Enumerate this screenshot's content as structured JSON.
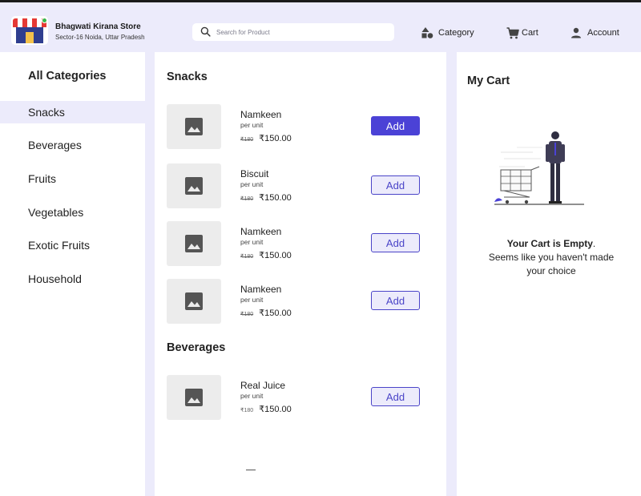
{
  "store": {
    "name": "Bhagwati Kirana Store",
    "address": "Sector-16 Noida, Uttar Pradesh"
  },
  "search": {
    "placeholder": "Search for Product"
  },
  "nav": {
    "category": "Category",
    "cart": "Cart",
    "account": "Account"
  },
  "sidebar": {
    "title": "All Categories",
    "items": [
      {
        "label": "Snacks",
        "active": true
      },
      {
        "label": "Beverages"
      },
      {
        "label": "Fruits"
      },
      {
        "label": "Vegetables"
      },
      {
        "label": "Exotic Fruits"
      },
      {
        "label": "Household"
      }
    ]
  },
  "sections": [
    {
      "title": "Snacks",
      "products": [
        {
          "name": "Namkeen",
          "unit": "per unit",
          "old_price": "₹180",
          "price": "₹150.00",
          "button": "Add"
        },
        {
          "name": "Biscuit",
          "unit": "per unit",
          "old_price": "₹180",
          "price": "₹150.00",
          "button": "Add"
        },
        {
          "name": "Namkeen",
          "unit": "per unit",
          "old_price": "₹180",
          "price": "₹150.00",
          "button": "Add"
        },
        {
          "name": "Namkeen",
          "unit": "per unit",
          "old_price": "₹180",
          "price": "₹150.00",
          "button": "Add"
        }
      ]
    },
    {
      "title": "Beverages",
      "products": [
        {
          "name": "Real Juice",
          "unit": "per unit",
          "old_price": "₹180",
          "price": "₹150.00",
          "button": "Add"
        }
      ]
    }
  ],
  "cart": {
    "title": "My Cart",
    "empty_title": "Your Cart is Empty",
    "empty_suffix": ".",
    "empty_text": "Seems like you haven't made your choice"
  },
  "colors": {
    "accent": "#4b42d6",
    "header_bg": "#ecebfb",
    "logo_awning": "#e53935"
  },
  "icons": [
    "search-icon",
    "category-icon",
    "cart-icon",
    "account-icon",
    "image-placeholder-icon"
  ]
}
